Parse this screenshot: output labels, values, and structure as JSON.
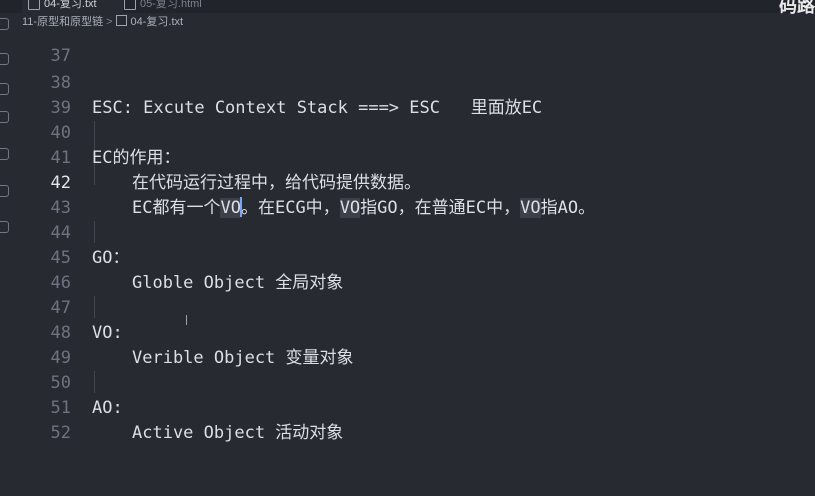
{
  "tabs": [
    {
      "label": "04-复习.txt",
      "active": true
    },
    {
      "label": "05-复习.html",
      "active": false
    }
  ],
  "window_title_partial": "码路",
  "breadcrumb": {
    "folder": "11-原型和原型链",
    "separator": ">",
    "file": "04-复习.txt"
  },
  "editor": {
    "current_line": "42",
    "lines": [
      {
        "num": "37",
        "text": ""
      },
      {
        "num": "38",
        "text": "ESC: Excute Context Stack ===> ESC   里面放EC"
      },
      {
        "num": "39",
        "text": ""
      },
      {
        "num": "40",
        "text": "EC的作用："
      },
      {
        "num": "41",
        "text": "在代码运行过程中，给代码提供数据。"
      },
      {
        "num": "42",
        "segments": [
          "EC都有一个",
          "VO",
          "",
          "。在ECG中，",
          "VO",
          "指GO，在普通EC中，",
          "VO",
          "指AO。"
        ]
      },
      {
        "num": "43",
        "text": ""
      },
      {
        "num": "44",
        "text": "GO："
      },
      {
        "num": "45",
        "text": "Globle Object 全局对象"
      },
      {
        "num": "46",
        "text": ""
      },
      {
        "num": "47",
        "text": "VO:"
      },
      {
        "num": "48",
        "text": "Verible Object 变量对象"
      },
      {
        "num": "49",
        "text": ""
      },
      {
        "num": "50",
        "text": "AO:"
      },
      {
        "num": "51",
        "text": "Active Object 活动对象"
      },
      {
        "num": "52",
        "text": ""
      }
    ]
  },
  "colors": {
    "background": "#272a31",
    "text": "#dcdfe4",
    "line_number": "#6d7380",
    "cursor": "#7aa2f7",
    "highlight": "#3c4048"
  }
}
